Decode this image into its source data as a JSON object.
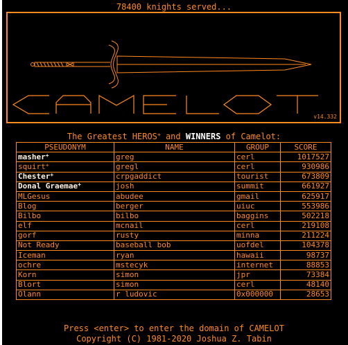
{
  "top_message": "78400 knights served...",
  "logo_text": "CAMELOT",
  "version": "v14.332",
  "heading": {
    "before": "The Greatest HEROS",
    "mark1": "+",
    "middle": " and ",
    "winners": "WINNERS",
    "after": " of Camelot:"
  },
  "columns": [
    "PSEUDONYM",
    "NAME",
    "GROUP",
    "SCORE"
  ],
  "rows": [
    {
      "pseudonym": "masher",
      "hero": true,
      "bold": true,
      "name": "greg",
      "group": "cerl",
      "score": "1017527"
    },
    {
      "pseudonym": "squirt",
      "hero": true,
      "bold": false,
      "name": "gregl",
      "group": "cerl",
      "score": "930986"
    },
    {
      "pseudonym": "Chester",
      "hero": true,
      "bold": true,
      "name": "crpgaddict",
      "group": "tourist",
      "score": "673809"
    },
    {
      "pseudonym": "Donal Graemae",
      "hero": true,
      "bold": true,
      "name": "josh",
      "group": "summit",
      "score": "661927"
    },
    {
      "pseudonym": "MLGesus",
      "hero": false,
      "bold": false,
      "name": "abudee",
      "group": "gmail",
      "score": "625917"
    },
    {
      "pseudonym": "Blog",
      "hero": false,
      "bold": false,
      "name": "berger",
      "group": "uiuc",
      "score": "553986"
    },
    {
      "pseudonym": "Bilbo",
      "hero": false,
      "bold": false,
      "name": "bilbo",
      "group": "baggins",
      "score": "502218"
    },
    {
      "pseudonym": "elf",
      "hero": false,
      "bold": false,
      "name": "mcnail",
      "group": "cerl",
      "score": "219108"
    },
    {
      "pseudonym": "gorf",
      "hero": false,
      "bold": false,
      "name": "rusty",
      "group": "minna",
      "score": "211224"
    },
    {
      "pseudonym": "Not Ready",
      "hero": false,
      "bold": false,
      "name": "baseball bob",
      "group": "uofdel",
      "score": "104378"
    },
    {
      "pseudonym": "Iceman",
      "hero": false,
      "bold": false,
      "name": "ryan",
      "group": "hawaii",
      "score": "98737"
    },
    {
      "pseudonym": "ochre",
      "hero": false,
      "bold": false,
      "name": "mstecyk",
      "group": "internet",
      "score": "88853"
    },
    {
      "pseudonym": "Korn",
      "hero": false,
      "bold": false,
      "name": "simon",
      "group": "jpr",
      "score": "73384"
    },
    {
      "pseudonym": "Blort",
      "hero": false,
      "bold": false,
      "name": "simon",
      "group": "cerl",
      "score": "48140"
    },
    {
      "pseudonym": "Olann",
      "hero": false,
      "bold": false,
      "name": "r ludovic",
      "group": "0x000000",
      "score": "28653"
    }
  ],
  "footer": {
    "line1": "Press <enter> to enter the domain of CAMELOT",
    "line2": "Copyright (C) 1981-2020 Joshua Z. Tabin"
  },
  "colors": {
    "foreground": "#ff8a1e",
    "background": "#000000",
    "highlight": "#ffffff"
  }
}
